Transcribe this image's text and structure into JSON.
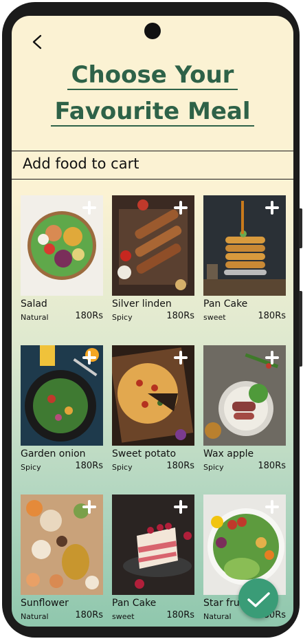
{
  "page": {
    "title_line1": "Choose Your",
    "title_line2": "Favourite Meal",
    "section_label": "Add food to cart"
  },
  "items": [
    {
      "name": "Salad",
      "tag": "Natural",
      "price": "180Rs"
    },
    {
      "name": "Silver linden",
      "tag": "Spicy",
      "price": "180Rs"
    },
    {
      "name": "Pan Cake",
      "tag": "sweet",
      "price": "180Rs"
    },
    {
      "name": "Garden onion",
      "tag": "Spicy",
      "price": "180Rs"
    },
    {
      "name": "Sweet potato",
      "tag": "Spicy",
      "price": "180Rs"
    },
    {
      "name": "Wax apple",
      "tag": "Spicy",
      "price": "180Rs"
    },
    {
      "name": "Sunflower",
      "tag": "Natural",
      "price": "180Rs"
    },
    {
      "name": "Pan Cake",
      "tag": "sweet",
      "price": "180Rs"
    },
    {
      "name": "Star fruit",
      "tag": "Natural",
      "price": "180Rs"
    }
  ],
  "colors": {
    "accent": "#2e6248",
    "fab": "#3a9c77",
    "background_top": "#fbf2d3",
    "background_bottom": "#8fc7ad"
  },
  "icons": {
    "back": "chevron-left-icon",
    "add": "plus-icon",
    "confirm": "check-icon"
  }
}
